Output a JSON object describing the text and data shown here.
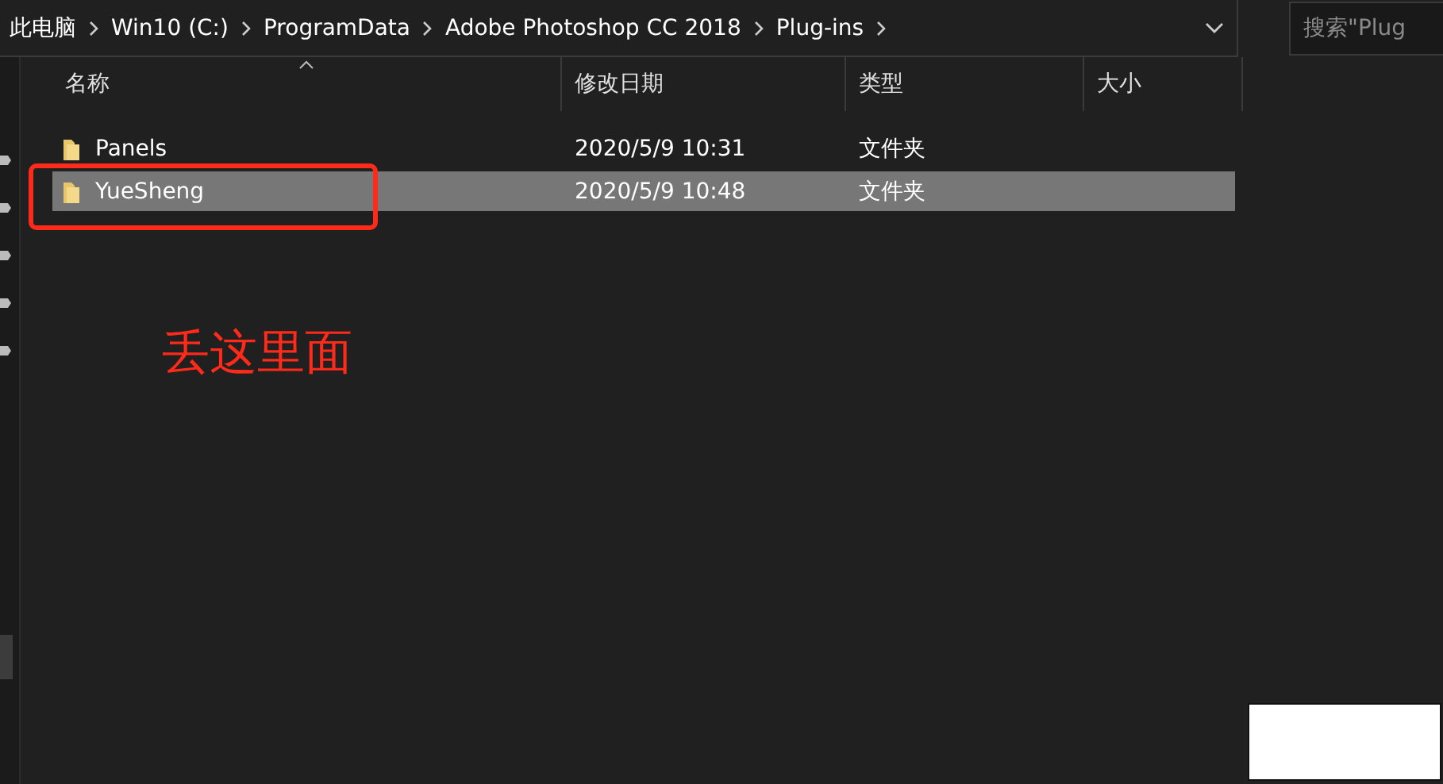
{
  "address_bar": {
    "crumbs": [
      "此电脑",
      "Win10 (C:)",
      "ProgramData",
      "Adobe Photoshop CC 2018",
      "Plug-ins"
    ]
  },
  "search": {
    "placeholder": "搜索\"Plug"
  },
  "table": {
    "columns": [
      {
        "label": "名称",
        "sorted": true
      },
      {
        "label": "修改日期",
        "sorted": false
      },
      {
        "label": "类型",
        "sorted": false
      },
      {
        "label": "大小",
        "sorted": false
      }
    ],
    "rows": [
      {
        "name": "Panels",
        "date": "2020/5/9 10:31",
        "type": "文件夹",
        "selected": false
      },
      {
        "name": "YueSheng",
        "date": "2020/5/9 10:48",
        "type": "文件夹",
        "selected": true
      }
    ]
  },
  "annotation": {
    "text": "丢这里面",
    "color": "#ff2a1a"
  }
}
